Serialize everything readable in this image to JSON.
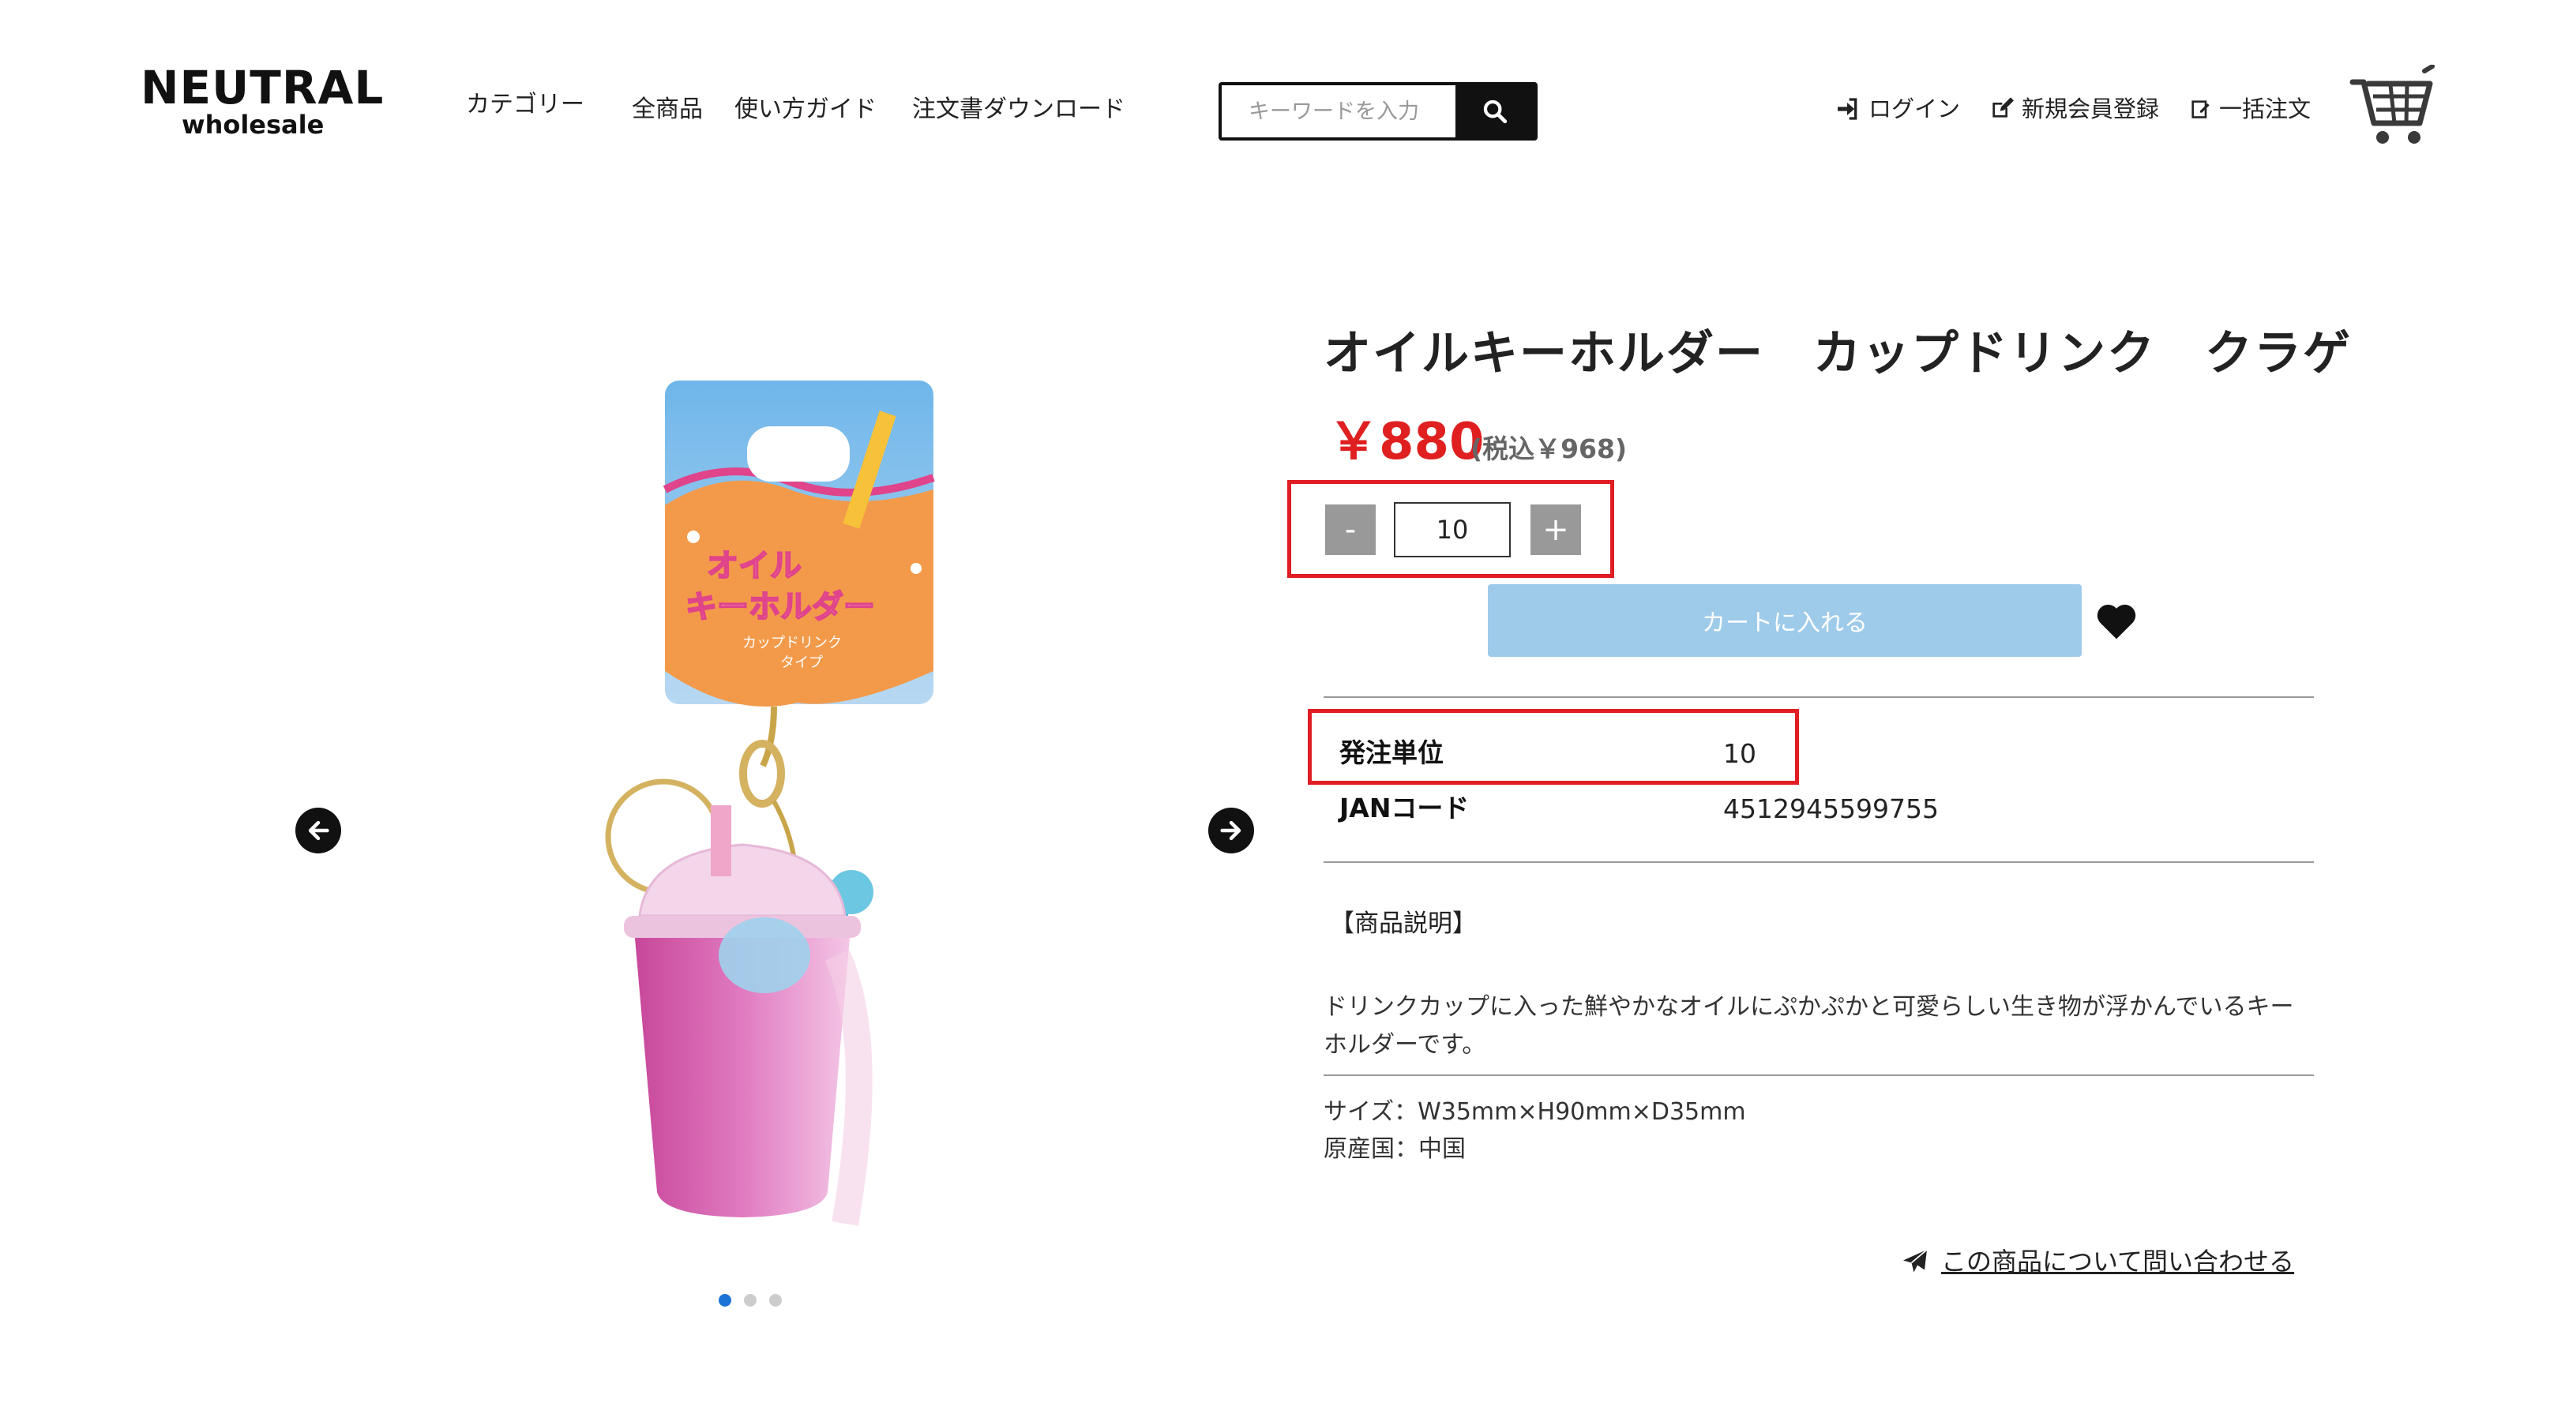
{
  "header": {
    "logo_main": "NEUTRAL",
    "logo_sub": "wholesale",
    "nav": [
      "カテゴリー",
      "全商品",
      "使い方ガイド",
      "注文書ダウンロード"
    ],
    "search_placeholder": "キーワードを入力",
    "login": "ログイン",
    "register": "新規会員登録",
    "bulk_order": "一括注文"
  },
  "product": {
    "title": "オイルキーホルダー　カップドリンク　クラゲ",
    "price": "￥880",
    "tax_price": "(税込￥968)",
    "quantity": "10",
    "minus": "-",
    "plus": "+",
    "cart_button": "カートに入れる",
    "specs": [
      {
        "label": "発注単位",
        "value": "10"
      },
      {
        "label": "JANコード",
        "value": "4512945599755"
      }
    ],
    "description_title": "【商品説明】",
    "description": "ドリンクカップに入った鮮やかなオイルにぷかぷかと可愛らしい生き物が浮かんでいるキーホルダーです。",
    "size": "サイズ：W35mm×H90mm×D35mm",
    "origin": "原産国：中国",
    "inquiry": "この商品について問い合わせる",
    "image_text": {
      "line1": "オイル",
      "line2": "キーホルダー",
      "line3": "カップドリンク",
      "line4": "タイプ"
    }
  },
  "carousel": {
    "slide_count": 3,
    "active_index": 0
  },
  "colors": {
    "price_red": "#e02020",
    "highlight_red": "#e11d24",
    "cart_button_blue": "#9fcbea",
    "dot_active": "#1e73d6"
  }
}
